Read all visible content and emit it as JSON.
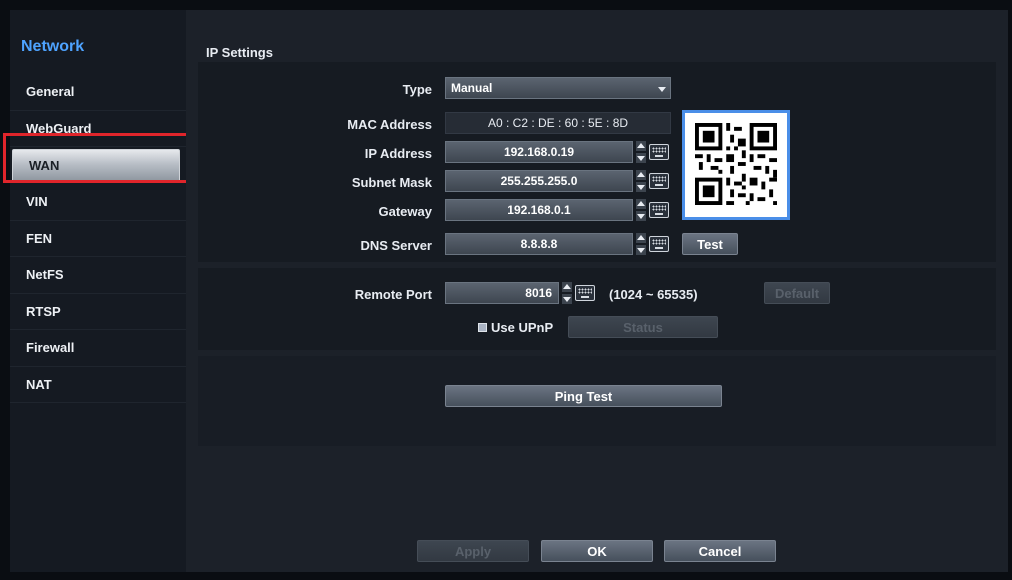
{
  "sidebar": {
    "title": "Network",
    "items": [
      {
        "label": "General"
      },
      {
        "label": "WebGuard"
      },
      {
        "label": "WAN"
      },
      {
        "label": "VIN"
      },
      {
        "label": "FEN"
      },
      {
        "label": "NetFS"
      },
      {
        "label": "RTSP"
      },
      {
        "label": "Firewall"
      },
      {
        "label": "NAT"
      }
    ],
    "active_index": 2
  },
  "ip_settings": {
    "section_title": "IP Settings",
    "type_label": "Type",
    "type_value": "Manual",
    "mac_label": "MAC Address",
    "mac_value": "A0 : C2 : DE : 60 : 5E : 8D",
    "ip_label": "IP Address",
    "ip_value": "192.168.0.19",
    "subnet_label": "Subnet Mask",
    "subnet_value": "255.255.255.0",
    "gateway_label": "Gateway",
    "gateway_value": "192.168.0.1",
    "dns_label": "DNS Server",
    "dns_value": "8.8.8.8",
    "test_label": "Test"
  },
  "remote": {
    "port_label": "Remote Port",
    "port_value": "8016",
    "port_range": "(1024 ~ 65535)",
    "default_label": "Default",
    "upnp_label": "Use UPnP",
    "status_label": "Status"
  },
  "ping": {
    "label": "Ping Test"
  },
  "footer": {
    "apply_label": "Apply",
    "ok_label": "OK",
    "cancel_label": "Cancel"
  },
  "colors": {
    "accent": "#4ea3ff",
    "highlight_border": "#e0252b",
    "qr_border": "#4a8ee8"
  },
  "icons": {
    "spinner": "spin-up-down-icon",
    "keyboard": "keyboard-icon",
    "dropdown": "chevron-down-icon",
    "qr": "qr-code-icon"
  }
}
